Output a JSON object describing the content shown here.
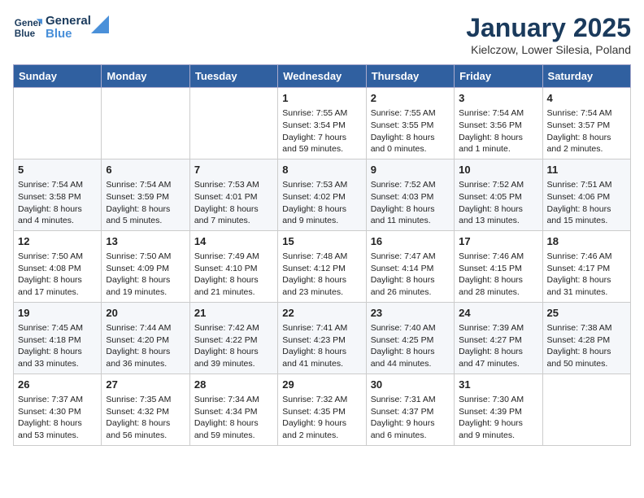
{
  "header": {
    "logo_line1": "General",
    "logo_line2": "Blue",
    "month_title": "January 2025",
    "location": "Kielczow, Lower Silesia, Poland"
  },
  "weekdays": [
    "Sunday",
    "Monday",
    "Tuesday",
    "Wednesday",
    "Thursday",
    "Friday",
    "Saturday"
  ],
  "weeks": [
    [
      {
        "day": "",
        "info": ""
      },
      {
        "day": "",
        "info": ""
      },
      {
        "day": "",
        "info": ""
      },
      {
        "day": "1",
        "info": "Sunrise: 7:55 AM\nSunset: 3:54 PM\nDaylight: 7 hours\nand 59 minutes."
      },
      {
        "day": "2",
        "info": "Sunrise: 7:55 AM\nSunset: 3:55 PM\nDaylight: 8 hours\nand 0 minutes."
      },
      {
        "day": "3",
        "info": "Sunrise: 7:54 AM\nSunset: 3:56 PM\nDaylight: 8 hours\nand 1 minute."
      },
      {
        "day": "4",
        "info": "Sunrise: 7:54 AM\nSunset: 3:57 PM\nDaylight: 8 hours\nand 2 minutes."
      }
    ],
    [
      {
        "day": "5",
        "info": "Sunrise: 7:54 AM\nSunset: 3:58 PM\nDaylight: 8 hours\nand 4 minutes."
      },
      {
        "day": "6",
        "info": "Sunrise: 7:54 AM\nSunset: 3:59 PM\nDaylight: 8 hours\nand 5 minutes."
      },
      {
        "day": "7",
        "info": "Sunrise: 7:53 AM\nSunset: 4:01 PM\nDaylight: 8 hours\nand 7 minutes."
      },
      {
        "day": "8",
        "info": "Sunrise: 7:53 AM\nSunset: 4:02 PM\nDaylight: 8 hours\nand 9 minutes."
      },
      {
        "day": "9",
        "info": "Sunrise: 7:52 AM\nSunset: 4:03 PM\nDaylight: 8 hours\nand 11 minutes."
      },
      {
        "day": "10",
        "info": "Sunrise: 7:52 AM\nSunset: 4:05 PM\nDaylight: 8 hours\nand 13 minutes."
      },
      {
        "day": "11",
        "info": "Sunrise: 7:51 AM\nSunset: 4:06 PM\nDaylight: 8 hours\nand 15 minutes."
      }
    ],
    [
      {
        "day": "12",
        "info": "Sunrise: 7:50 AM\nSunset: 4:08 PM\nDaylight: 8 hours\nand 17 minutes."
      },
      {
        "day": "13",
        "info": "Sunrise: 7:50 AM\nSunset: 4:09 PM\nDaylight: 8 hours\nand 19 minutes."
      },
      {
        "day": "14",
        "info": "Sunrise: 7:49 AM\nSunset: 4:10 PM\nDaylight: 8 hours\nand 21 minutes."
      },
      {
        "day": "15",
        "info": "Sunrise: 7:48 AM\nSunset: 4:12 PM\nDaylight: 8 hours\nand 23 minutes."
      },
      {
        "day": "16",
        "info": "Sunrise: 7:47 AM\nSunset: 4:14 PM\nDaylight: 8 hours\nand 26 minutes."
      },
      {
        "day": "17",
        "info": "Sunrise: 7:46 AM\nSunset: 4:15 PM\nDaylight: 8 hours\nand 28 minutes."
      },
      {
        "day": "18",
        "info": "Sunrise: 7:46 AM\nSunset: 4:17 PM\nDaylight: 8 hours\nand 31 minutes."
      }
    ],
    [
      {
        "day": "19",
        "info": "Sunrise: 7:45 AM\nSunset: 4:18 PM\nDaylight: 8 hours\nand 33 minutes."
      },
      {
        "day": "20",
        "info": "Sunrise: 7:44 AM\nSunset: 4:20 PM\nDaylight: 8 hours\nand 36 minutes."
      },
      {
        "day": "21",
        "info": "Sunrise: 7:42 AM\nSunset: 4:22 PM\nDaylight: 8 hours\nand 39 minutes."
      },
      {
        "day": "22",
        "info": "Sunrise: 7:41 AM\nSunset: 4:23 PM\nDaylight: 8 hours\nand 41 minutes."
      },
      {
        "day": "23",
        "info": "Sunrise: 7:40 AM\nSunset: 4:25 PM\nDaylight: 8 hours\nand 44 minutes."
      },
      {
        "day": "24",
        "info": "Sunrise: 7:39 AM\nSunset: 4:27 PM\nDaylight: 8 hours\nand 47 minutes."
      },
      {
        "day": "25",
        "info": "Sunrise: 7:38 AM\nSunset: 4:28 PM\nDaylight: 8 hours\nand 50 minutes."
      }
    ],
    [
      {
        "day": "26",
        "info": "Sunrise: 7:37 AM\nSunset: 4:30 PM\nDaylight: 8 hours\nand 53 minutes."
      },
      {
        "day": "27",
        "info": "Sunrise: 7:35 AM\nSunset: 4:32 PM\nDaylight: 8 hours\nand 56 minutes."
      },
      {
        "day": "28",
        "info": "Sunrise: 7:34 AM\nSunset: 4:34 PM\nDaylight: 8 hours\nand 59 minutes."
      },
      {
        "day": "29",
        "info": "Sunrise: 7:32 AM\nSunset: 4:35 PM\nDaylight: 9 hours\nand 2 minutes."
      },
      {
        "day": "30",
        "info": "Sunrise: 7:31 AM\nSunset: 4:37 PM\nDaylight: 9 hours\nand 6 minutes."
      },
      {
        "day": "31",
        "info": "Sunrise: 7:30 AM\nSunset: 4:39 PM\nDaylight: 9 hours\nand 9 minutes."
      },
      {
        "day": "",
        "info": ""
      }
    ]
  ]
}
